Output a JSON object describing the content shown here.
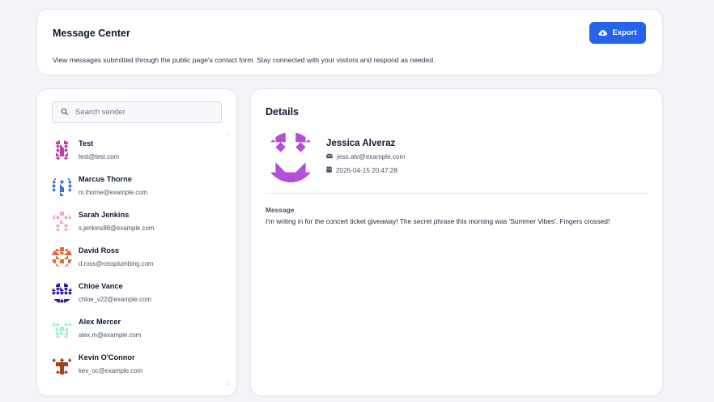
{
  "header": {
    "title": "Message Center",
    "description": "View messages submitted through the public page's contact form. Stay connected with your visitors and respond as needed.",
    "export_label": "Export",
    "accent_color": "#2563eb"
  },
  "sidebar": {
    "search_placeholder": "Search sender",
    "senders": [
      {
        "name": "Test",
        "email": "test@test.com",
        "avatar_color": "#c03fa8"
      },
      {
        "name": "Marcus Thorne",
        "email": "m.thorne@example.com",
        "avatar_color": "#3a6fd8"
      },
      {
        "name": "Sarah Jenkins",
        "email": "s.jenkins88@example.com",
        "avatar_color": "#f2a6c2"
      },
      {
        "name": "David Ross",
        "email": "d.ross@rossplumbing.com",
        "avatar_color": "#e0683a"
      },
      {
        "name": "Chloe Vance",
        "email": "chloe_v22@example.com",
        "avatar_color": "#3d1aa6"
      },
      {
        "name": "Alex Mercer",
        "email": "alex.m@example.com",
        "avatar_color": "#a6ecd9"
      },
      {
        "name": "Kevin O'Connor",
        "email": "kev_oc@example.com",
        "avatar_color": "#a3411c"
      }
    ]
  },
  "details": {
    "title": "Details",
    "name": "Jessica Alveraz",
    "email": "jess.alv@example.com",
    "date": "2026-04-15 20:47:28",
    "avatar_color": "#b34fd6",
    "message_label": "Message",
    "message": "I'm writing in for the concert ticket giveaway! The secret phrase this morning was 'Summer Vibes'. Fingers crossed!"
  }
}
